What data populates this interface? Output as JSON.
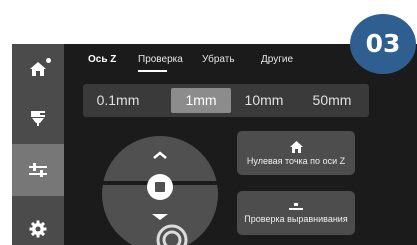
{
  "badge": {
    "text": "03",
    "color": "#2f5e91"
  },
  "sidebar": {
    "items": [
      {
        "icon": "home-icon",
        "active": false,
        "notification_dot": true
      },
      {
        "icon": "nozzle-icon",
        "active": false
      },
      {
        "icon": "sliders-icon",
        "active": true
      },
      {
        "icon": "gear-icon",
        "active": false
      }
    ]
  },
  "tabs": [
    {
      "label": "Ось Z",
      "active": true
    },
    {
      "label": "Проверка",
      "active": false
    },
    {
      "label": "Убрать",
      "active": false
    },
    {
      "label": "Другие",
      "active": false
    }
  ],
  "steps": {
    "options": [
      "0.1mm",
      "1mm",
      "10mm",
      "50mm"
    ],
    "selected": "1mm"
  },
  "jog": {
    "up_icon": "chevron-up-icon",
    "center_icon": "stop-icon",
    "down_icon": "chevron-down-icon",
    "overlay_icon": "tap-gesture-icon"
  },
  "actions": {
    "z_home": {
      "label": "Нулевая точка по оси Z",
      "icon": "home-icon"
    },
    "leveling": {
      "label": "Проверка выравнивания",
      "icon": "bed-level-icon"
    }
  }
}
